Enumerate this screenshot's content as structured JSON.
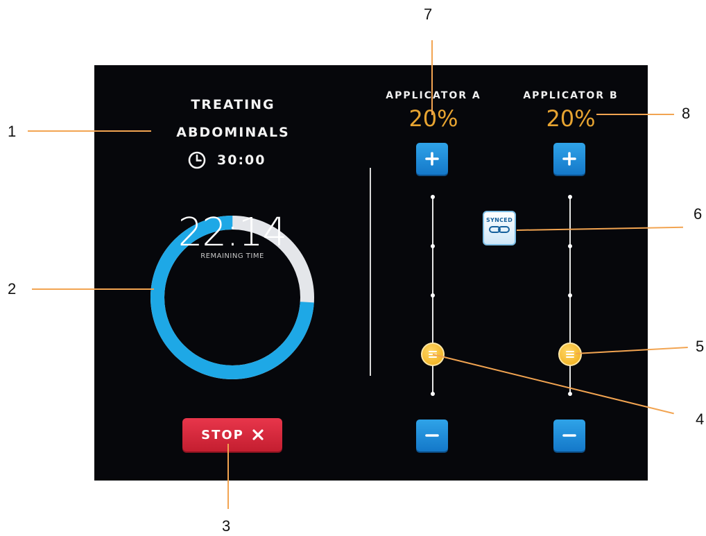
{
  "treatment": {
    "title_line1": "TREATING",
    "title_line2": "ABDOMINALS",
    "duration": "30:00",
    "remaining_time": "22:14",
    "remaining_label": "REMAINING TIME",
    "progress_elapsed_fraction": 0.26,
    "stop_label": "STOP",
    "stop_icon": "close-icon"
  },
  "applicators": [
    {
      "title": "APPLICATOR A",
      "percent": "20%",
      "level_fraction": 0.2,
      "plus_icon": "plus-icon",
      "minus_icon": "minus-icon"
    },
    {
      "title": "APPLICATOR B",
      "percent": "20%",
      "level_fraction": 0.2,
      "plus_icon": "plus-icon",
      "minus_icon": "minus-icon"
    }
  ],
  "sync": {
    "label": "SYNCED",
    "icon": "link-icon"
  },
  "callouts": [
    "1",
    "2",
    "3",
    "4",
    "5",
    "6",
    "7",
    "8"
  ],
  "colors": {
    "screen_bg": "#06070b",
    "ring_active": "#1ea8e6",
    "ring_elapsed": "#e4e6ea",
    "accent_orange": "#e7a431",
    "knob_yellow": "#f3b528",
    "button_blue": "#1f8fd9",
    "stop_red": "#d7283c",
    "leader_orange": "#f2a451"
  }
}
